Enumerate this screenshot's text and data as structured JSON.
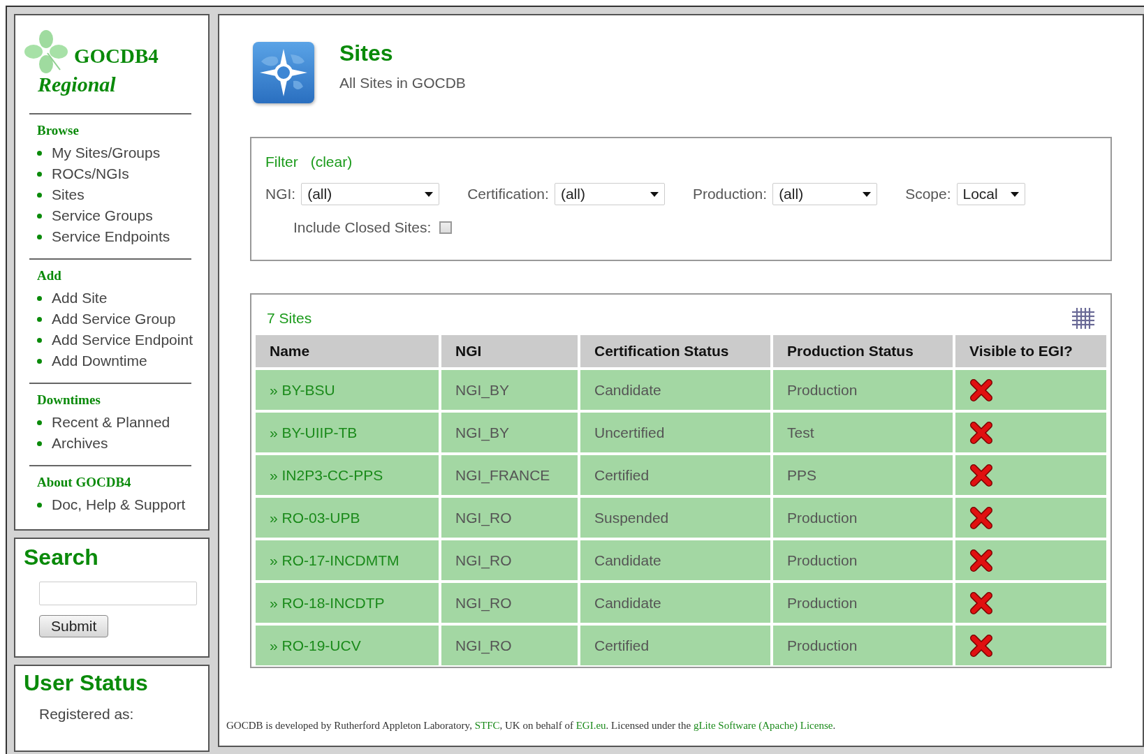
{
  "logo": {
    "title": "GOCDB4",
    "subtitle": "Regional"
  },
  "sidebar": {
    "sections": [
      {
        "heading": "Browse",
        "items": [
          "My Sites/Groups",
          "ROCs/NGIs",
          "Sites",
          "Service Groups",
          "Service Endpoints"
        ]
      },
      {
        "heading": "Add",
        "items": [
          "Add Site",
          "Add Service Group",
          "Add Service Endpoint",
          "Add Downtime"
        ]
      },
      {
        "heading": "Downtimes",
        "items": [
          "Recent & Planned",
          "Archives"
        ]
      },
      {
        "heading": "About GOCDB4",
        "items": [
          "Doc, Help & Support"
        ]
      }
    ]
  },
  "search": {
    "heading": "Search",
    "button": "Submit"
  },
  "user_status": {
    "heading": "User Status",
    "text": "Registered as:"
  },
  "page": {
    "title": "Sites",
    "subtitle": "All Sites in GOCDB"
  },
  "filter": {
    "title": "Filter",
    "clear": "(clear)",
    "selects": [
      {
        "label": "NGI:",
        "value": "(all)"
      },
      {
        "label": "Certification:",
        "value": "(all)"
      },
      {
        "label": "Production:",
        "value": "(all)"
      },
      {
        "label": "Scope:",
        "value": "Local"
      }
    ],
    "include_closed": {
      "label": "Include Closed Sites:",
      "checked": false
    }
  },
  "table": {
    "count": "7 Sites",
    "columns": [
      "Name",
      "NGI",
      "Certification Status",
      "Production Status",
      "Visible to EGI?"
    ],
    "rows": [
      {
        "name": "» BY-BSU",
        "ngi": "NGI_BY",
        "certification": "Candidate",
        "production": "Production",
        "visible": false
      },
      {
        "name": "» BY-UIIP-TB",
        "ngi": "NGI_BY",
        "certification": "Uncertified",
        "production": "Test",
        "visible": false
      },
      {
        "name": "» IN2P3-CC-PPS",
        "ngi": "NGI_FRANCE",
        "certification": "Certified",
        "production": "PPS",
        "visible": false
      },
      {
        "name": "» RO-03-UPB",
        "ngi": "NGI_RO",
        "certification": "Suspended",
        "production": "Production",
        "visible": false
      },
      {
        "name": "» RO-17-INCDMTM",
        "ngi": "NGI_RO",
        "certification": "Candidate",
        "production": "Production",
        "visible": false
      },
      {
        "name": "» RO-18-INCDTP",
        "ngi": "NGI_RO",
        "certification": "Candidate",
        "production": "Production",
        "visible": false
      },
      {
        "name": "» RO-19-UCV",
        "ngi": "NGI_RO",
        "certification": "Certified",
        "production": "Production",
        "visible": false
      }
    ]
  },
  "footer": [
    {
      "kind": "text",
      "text": "GOCDB is developed by Rutherford Appleton Laboratory, "
    },
    {
      "kind": "link",
      "text": "STFC"
    },
    {
      "kind": "text",
      "text": ", UK on behalf of "
    },
    {
      "kind": "link",
      "text": "EGI.eu"
    },
    {
      "kind": "text",
      "text": ". Licensed under the "
    },
    {
      "kind": "link",
      "text": "gLite Software (Apache) License"
    },
    {
      "kind": "text",
      "text": "."
    }
  ]
}
